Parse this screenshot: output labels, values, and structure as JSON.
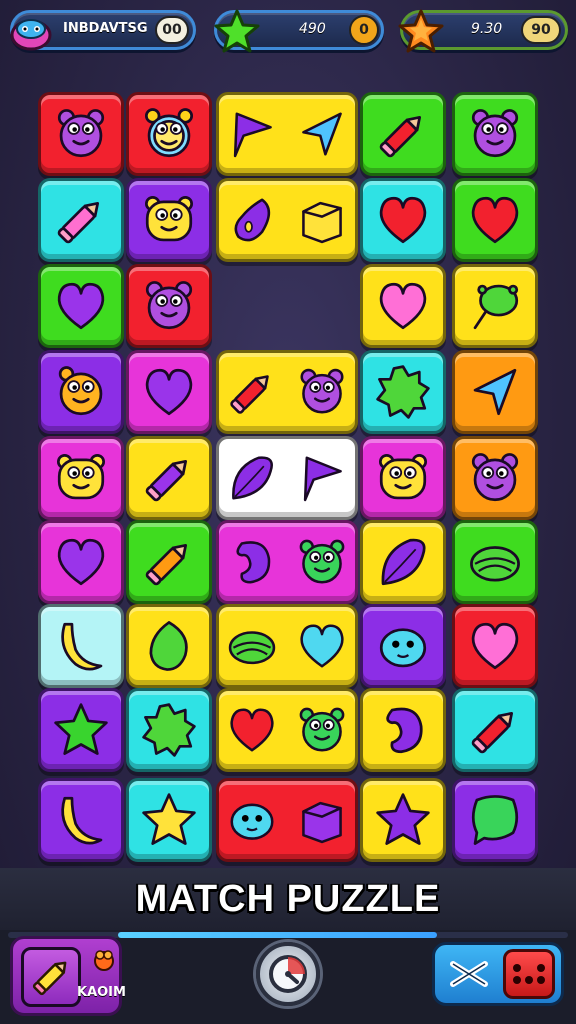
{
  "hud": {
    "player": {
      "name": "INBDAVTSG",
      "badge": "00",
      "icon": "blob-monster-icon"
    },
    "moves": {
      "value": "490",
      "badge": "0",
      "icon": "green-star-icon"
    },
    "score": {
      "value": "9.30",
      "badge": "90",
      "icon": "orange-star-icon"
    }
  },
  "colors": {
    "red": "#f2212e",
    "yellow": "#ffe11a",
    "green": "#3fdc1f",
    "cyan": "#2fe2e4",
    "purple": "#8c2ee6",
    "magenta": "#e734d9",
    "orange": "#ff9a12",
    "lightcyan": "#b4f4f6",
    "white": "#ffffff"
  },
  "board": {
    "tiles": [
      {
        "color": "red",
        "icons": [
          "bear-face-icon"
        ]
      },
      {
        "color": "red",
        "icons": [
          "alarm-clock-face-icon"
        ]
      },
      {
        "color": "yellow",
        "icons": [
          "flag-pennant-icon",
          "arrow-cursor-icon"
        ]
      },
      {
        "color": "green",
        "icons": [
          "red-pencil-icon"
        ]
      },
      {
        "color": "green",
        "icons": [
          "bear-face-icon"
        ]
      },
      {
        "color": "cyan",
        "icons": [
          "pink-pencil-icon"
        ]
      },
      {
        "color": "purple",
        "icons": [
          "yellow-monster-face-icon"
        ]
      },
      {
        "color": "yellow",
        "icons": [
          "eggplant-icon",
          "cube-icon"
        ]
      },
      {
        "color": "cyan",
        "icons": [
          "red-heart-icon"
        ]
      },
      {
        "color": "green",
        "icons": [
          "red-heart-icon"
        ]
      },
      {
        "color": "green",
        "icons": [
          "purple-heart-icon"
        ]
      },
      {
        "color": "red",
        "icons": [
          "bear-face-icon"
        ]
      },
      {
        "color": "yellow",
        "icons": [
          "pink-heart-icon"
        ]
      },
      {
        "color": "yellow",
        "icons": [
          "green-balloon-icon"
        ]
      },
      {
        "color": "purple",
        "icons": [
          "orange-monster-face-icon"
        ]
      },
      {
        "color": "magenta",
        "icons": [
          "purple-heart-icon"
        ]
      },
      {
        "color": "yellow",
        "icons": [
          "red-pencil-icon",
          "bear-face-icon"
        ]
      },
      {
        "color": "cyan",
        "icons": [
          "green-splat-icon"
        ]
      },
      {
        "color": "orange",
        "icons": [
          "arrow-cursor-icon"
        ]
      },
      {
        "color": "magenta",
        "icons": [
          "yellow-monster-face-icon"
        ]
      },
      {
        "color": "yellow",
        "icons": [
          "purple-pencil-icon"
        ]
      },
      {
        "color": "white",
        "icons": [
          "purple-leaf-icon",
          "flag-pennant-icon"
        ]
      },
      {
        "color": "magenta",
        "icons": [
          "yellow-monster-face-icon"
        ]
      },
      {
        "color": "orange",
        "icons": [
          "bear-face-icon"
        ]
      },
      {
        "color": "magenta",
        "icons": [
          "purple-heart-icon"
        ]
      },
      {
        "color": "green",
        "icons": [
          "orange-pencil-icon"
        ]
      },
      {
        "color": "magenta",
        "icons": [
          "purple-bean-icon",
          "green-monster-face-icon"
        ]
      },
      {
        "color": "yellow",
        "icons": [
          "purple-leaf-icon"
        ]
      },
      {
        "color": "green",
        "icons": [
          "green-shell-icon"
        ]
      },
      {
        "color": "lightcyan",
        "icons": [
          "banana-icon"
        ]
      },
      {
        "color": "yellow",
        "icons": [
          "green-leaf-icon"
        ]
      },
      {
        "color": "yellow",
        "icons": [
          "green-shell-icon",
          "cyan-heart-icon"
        ]
      },
      {
        "color": "purple",
        "icons": [
          "cyan-blob-icon"
        ]
      },
      {
        "color": "red",
        "icons": [
          "pink-heart-icon"
        ]
      },
      {
        "color": "purple",
        "icons": [
          "green-star-icon"
        ]
      },
      {
        "color": "cyan",
        "icons": [
          "green-splat-icon"
        ]
      },
      {
        "color": "yellow",
        "icons": [
          "red-heart-icon",
          "green-monster-face-icon"
        ]
      },
      {
        "color": "yellow",
        "icons": [
          "purple-bean-icon"
        ]
      },
      {
        "color": "cyan",
        "icons": [
          "red-pencil-icon"
        ]
      },
      {
        "color": "purple",
        "icons": [
          "banana-icon"
        ]
      },
      {
        "color": "cyan",
        "icons": [
          "yellow-star-icon"
        ]
      },
      {
        "color": "red",
        "icons": [
          "cyan-blob-icon",
          "purple-cube-icon"
        ]
      },
      {
        "color": "yellow",
        "icons": [
          "purple-star-icon"
        ]
      },
      {
        "color": "purple",
        "icons": [
          "green-speech-bubble-icon"
        ]
      }
    ]
  },
  "banner": {
    "title": "MATCH PUZZLE"
  },
  "bottom": {
    "progress": 0.57,
    "left_label": "KAOIM",
    "left_icon": "pencil-icon",
    "gem_icon": "orange-gem-icon",
    "center_icon": "timer-dial-icon",
    "shuffle_icon": "shuffle-x-icon",
    "dice_icon": "dice-icon"
  }
}
